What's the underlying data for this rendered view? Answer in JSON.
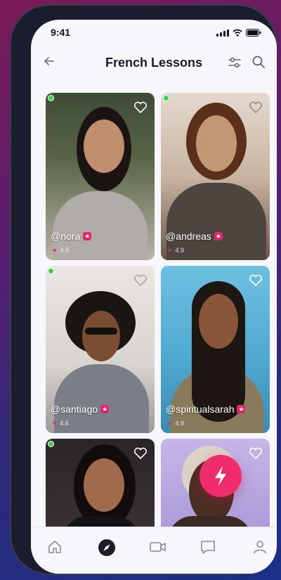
{
  "status": {
    "time": "9:41"
  },
  "header": {
    "title": "French Lessons",
    "back_icon": "arrow-left-icon",
    "filter_icon": "sliders-icon",
    "search_icon": "search-icon"
  },
  "tutors": [
    {
      "handle": "@nora",
      "rating": "4.9",
      "online": true
    },
    {
      "handle": "@andreas",
      "rating": "4.9",
      "online": true
    },
    {
      "handle": "@santiago",
      "rating": "4.6",
      "online": true
    },
    {
      "handle": "@spiritualsarah",
      "rating": "4.9",
      "online": false
    },
    {
      "handle": "",
      "rating": "",
      "online": true
    },
    {
      "handle": "",
      "rating": "",
      "online": false
    }
  ],
  "colors": {
    "accent": "#ef2d6d",
    "online": "#3fcf4a",
    "nav_active": "#1c1c2b"
  },
  "nav": {
    "items": [
      "home-icon",
      "explore-icon",
      "video-icon",
      "chat-icon",
      "profile-icon"
    ],
    "active": "explore-icon"
  }
}
